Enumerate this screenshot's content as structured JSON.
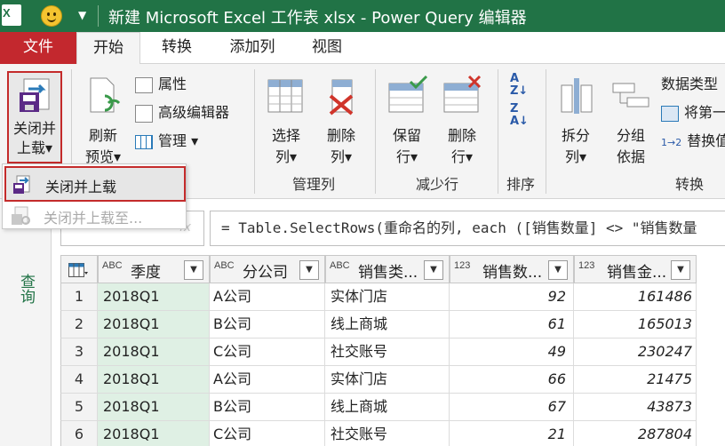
{
  "titlebar": {
    "app_icon_text": "X",
    "title": "新建 Microsoft Excel 工作表 xlsx - Power Query 编辑器"
  },
  "tabs": [
    {
      "label": "文件"
    },
    {
      "label": "开始"
    },
    {
      "label": "转换"
    },
    {
      "label": "添加列"
    },
    {
      "label": "视图"
    }
  ],
  "ribbon": {
    "close_load": {
      "line1": "关闭并",
      "line2": "上载▾"
    },
    "refresh": {
      "line1": "刷新",
      "line2": "预览▾"
    },
    "properties": "属性",
    "advanced_editor": "高级编辑器",
    "manage": "管理 ▾",
    "choose_cols": {
      "line1": "选择",
      "line2": "列▾"
    },
    "remove_cols": {
      "line1": "删除",
      "line2": "列▾"
    },
    "manage_cols_group": "管理列",
    "keep_rows": {
      "line1": "保留",
      "line2": "行▾"
    },
    "remove_rows": {
      "line1": "删除",
      "line2": "行▾"
    },
    "reduce_rows_group": "减少行",
    "sort_group": "排序",
    "split": {
      "line1": "拆分",
      "line2": "列▾"
    },
    "group_by": {
      "line1": "分组",
      "line2": "依据"
    },
    "data_type": "数据类型",
    "first_row": "将第一",
    "replace": "替换值",
    "transform_group": "转换"
  },
  "dropdown": {
    "item1": "关闭并上载",
    "item2": "关闭并上载至..."
  },
  "query_pane_label": "查询",
  "formula": "= Table.SelectRows(重命名的列, each ([销售数量] <> \"销售数量",
  "table": {
    "columns": [
      {
        "type": "ABC",
        "name": "季度"
      },
      {
        "type": "ABC",
        "name": "分公司"
      },
      {
        "type": "ABC",
        "name": "销售类..."
      },
      {
        "type": "123",
        "name": "销售数..."
      },
      {
        "type": "123",
        "name": "销售金..."
      }
    ],
    "rows": [
      {
        "idx": "1",
        "quarter": "2018Q1",
        "company": "A公司",
        "channel": "实体门店",
        "qty": "92",
        "amount": "161486"
      },
      {
        "idx": "2",
        "quarter": "2018Q1",
        "company": "B公司",
        "channel": "线上商城",
        "qty": "61",
        "amount": "165013"
      },
      {
        "idx": "3",
        "quarter": "2018Q1",
        "company": "C公司",
        "channel": "社交账号",
        "qty": "49",
        "amount": "230247"
      },
      {
        "idx": "4",
        "quarter": "2018Q1",
        "company": "A公司",
        "channel": "实体门店",
        "qty": "66",
        "amount": "21475"
      },
      {
        "idx": "5",
        "quarter": "2018Q1",
        "company": "B公司",
        "channel": "线上商城",
        "qty": "67",
        "amount": "43873"
      },
      {
        "idx": "6",
        "quarter": "2018Q1",
        "company": "C公司",
        "channel": "社交账号",
        "qty": "21",
        "amount": "287804"
      }
    ]
  },
  "colors": {
    "excel_green": "#217346",
    "file_red": "#c3282e",
    "highlight_red": "#c42b2b",
    "quarter_col_bg": "#dff0e4"
  }
}
